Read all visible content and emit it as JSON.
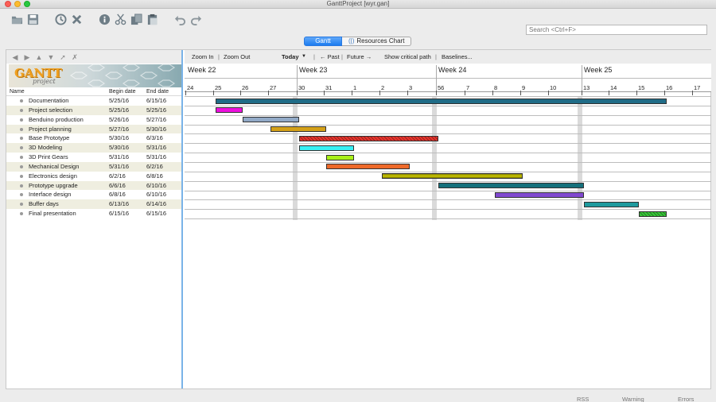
{
  "window": {
    "title": "GanttProject [wyr.gan]"
  },
  "toolbar": {
    "icons": [
      "open-icon",
      "save-icon",
      "history-icon",
      "delete-icon",
      "info-icon",
      "cut-icon",
      "copy-icon",
      "paste-icon",
      "undo-icon",
      "redo-icon"
    ],
    "search_placeholder": "Search <Ctrl+F>"
  },
  "tabs": {
    "gantt": "Gantt",
    "resources": "Resources Chart"
  },
  "tree": {
    "columns": {
      "name": "Name",
      "begin": "Begin date",
      "end": "End date"
    },
    "logo_text": "GANTT",
    "logo_sub": "project"
  },
  "tasks": [
    {
      "name": "Documentation",
      "begin": "5/25/16",
      "end": "6/15/16",
      "color": "#206c87",
      "pattern": "solid"
    },
    {
      "name": "Project selection",
      "begin": "5/25/16",
      "end": "5/25/16",
      "color": "#ee10de",
      "pattern": "solid"
    },
    {
      "name": "Benduino production",
      "begin": "5/26/16",
      "end": "5/27/16",
      "color": "#92aac7",
      "pattern": "solid"
    },
    {
      "name": "Project planning",
      "begin": "5/27/16",
      "end": "5/30/16",
      "color": "#d4a017",
      "pattern": "solid"
    },
    {
      "name": "Base Prototype",
      "begin": "5/30/16",
      "end": "6/3/16",
      "color": "#e8342c",
      "pattern": "hatch"
    },
    {
      "name": "3D Modeling",
      "begin": "5/30/16",
      "end": "5/31/16",
      "color": "#38f0f4",
      "pattern": "solid"
    },
    {
      "name": "3D Print Gears",
      "begin": "5/31/16",
      "end": "5/31/16",
      "color": "#a8f018",
      "pattern": "solid"
    },
    {
      "name": "Mechanical Design",
      "begin": "5/31/16",
      "end": "6/2/16",
      "color": "#ee6a2a",
      "pattern": "solid"
    },
    {
      "name": "Electronics design",
      "begin": "6/2/16",
      "end": "6/8/16",
      "color": "#e6e000",
      "pattern": "stripes"
    },
    {
      "name": "Prototype upgrade",
      "begin": "6/6/16",
      "end": "6/10/16",
      "color": "#16707c",
      "pattern": "solid"
    },
    {
      "name": "Interface design",
      "begin": "6/8/16",
      "end": "6/10/16",
      "color": "#6a28c8",
      "pattern": "dots"
    },
    {
      "name": "Buffer days",
      "begin": "6/13/16",
      "end": "6/14/16",
      "color": "#1e9a9e",
      "pattern": "solid"
    },
    {
      "name": "Final presentation",
      "begin": "6/15/16",
      "end": "6/15/16",
      "color": "#38c838",
      "pattern": "hatch"
    }
  ],
  "chart": {
    "zoom_in": "Zoom In",
    "zoom_out": "Zoom Out",
    "today": "Today",
    "past": "← Past",
    "future": "Future →",
    "critical": "Show critical path",
    "baselines": "Baselines...",
    "weeks": [
      "Week 22",
      "Week 23",
      "Week 24",
      "Week 25"
    ],
    "days": [
      "24",
      "25",
      "26",
      "27",
      "30",
      "31",
      "1",
      "2",
      "3",
      "56",
      "7",
      "8",
      "9",
      "10",
      "13",
      "14",
      "15",
      "16",
      "17"
    ]
  },
  "statusbar": {
    "rss": "RSS",
    "warning": "Warning",
    "errors": "Errors"
  }
}
